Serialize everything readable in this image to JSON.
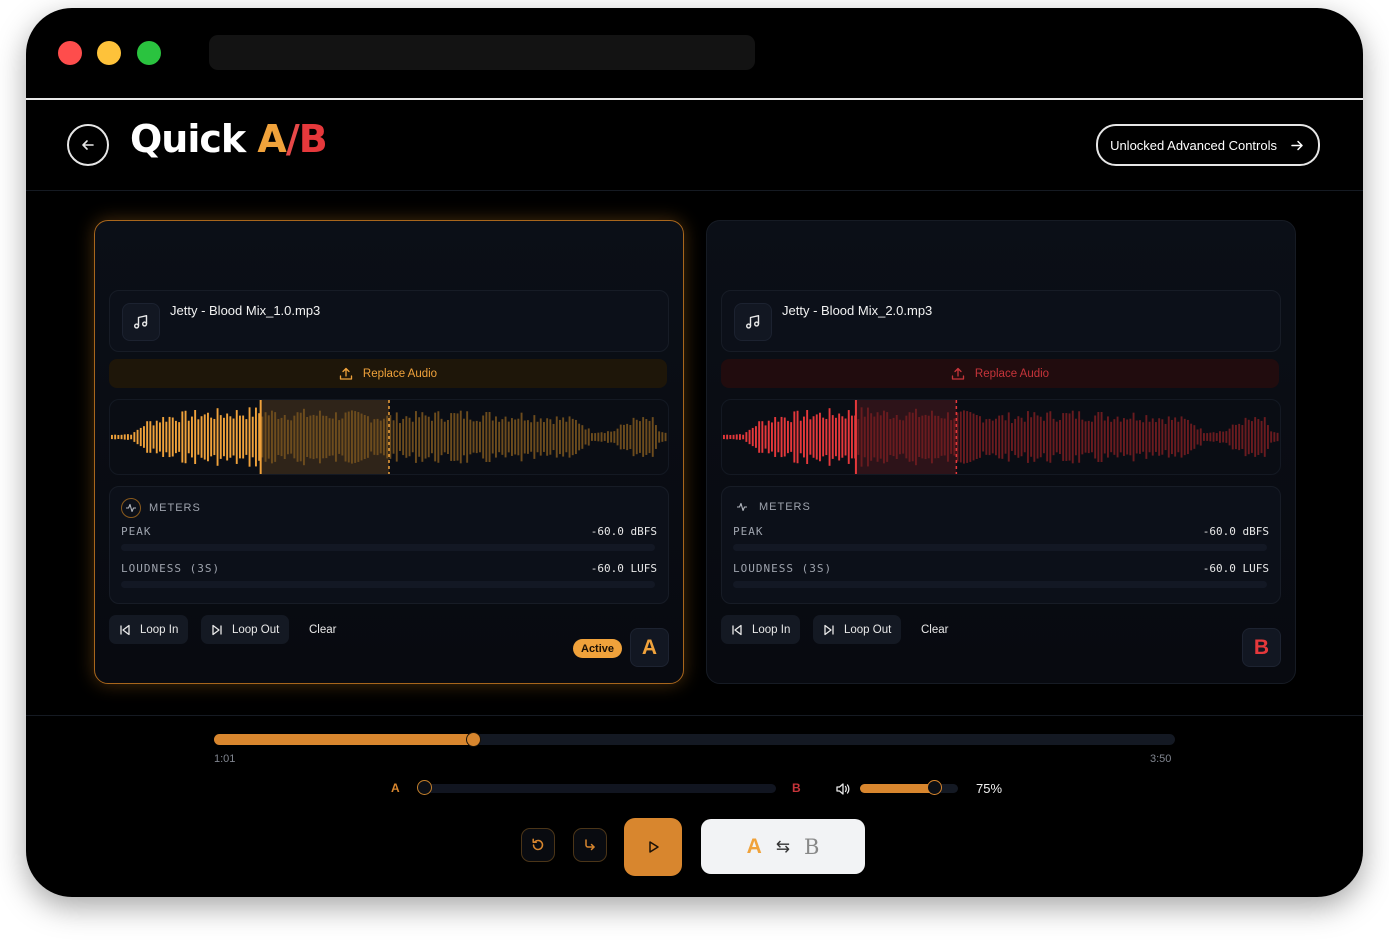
{
  "header": {
    "title_main": "Quick ",
    "title_a": "A",
    "title_slash": "/",
    "title_b": "B",
    "advanced_label": "Unlocked Advanced Controls"
  },
  "deck_a": {
    "file_name": "Jetty - Blood Mix_1.0.mp3",
    "replace_label": "Replace Audio",
    "meters_title": "METERS",
    "peak_label": "PEAK",
    "peak_value": "-60.0 dBFS",
    "loudness_label": "LOUDNESS (3S)",
    "loudness_value": "-60.0 LUFS",
    "loop_in_label": "Loop In",
    "loop_out_label": "Loop Out",
    "clear_label": "Clear",
    "active_label": "Active",
    "letter": "A",
    "color": "#f0a23b"
  },
  "deck_b": {
    "file_name": "Jetty - Blood Mix_2.0.mp3",
    "replace_label": "Replace Audio",
    "meters_title": "METERS",
    "peak_label": "PEAK",
    "peak_value": "-60.0 dBFS",
    "loudness_label": "LOUDNESS (3S)",
    "loudness_value": "-60.0 LUFS",
    "loop_in_label": "Loop In",
    "loop_out_label": "Loop Out",
    "clear_label": "Clear",
    "letter": "B",
    "color": "#e5383b"
  },
  "transport": {
    "position_fraction": 0.27,
    "time_start": "1:01",
    "time_end": "3:50",
    "crossfade_a_label": "A",
    "crossfade_b_label": "B",
    "crossfade_fraction": 0.0,
    "volume_fraction": 0.75,
    "volume_label": "75%",
    "switch_a": "A",
    "switch_b": "B",
    "switch_symbol": "⇆"
  },
  "colors": {
    "accent_a": "#f0a23b",
    "accent_b": "#e5383b",
    "transport_accent": "#d8862e"
  }
}
